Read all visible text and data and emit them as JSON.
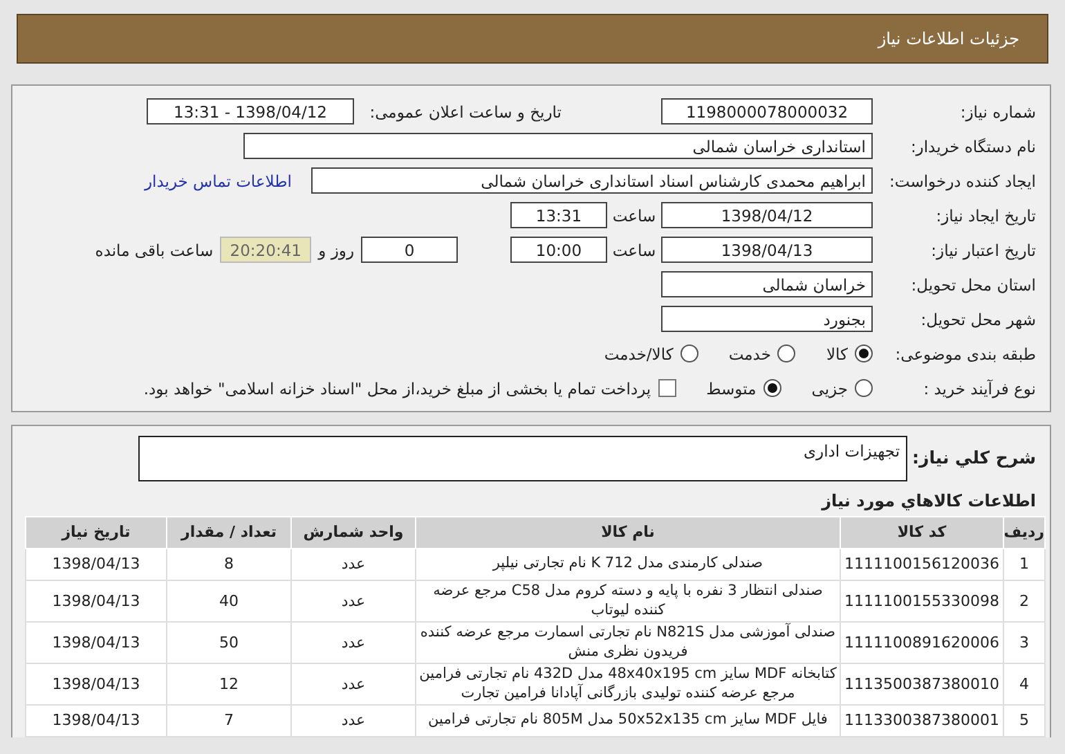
{
  "header": {
    "title": "جزئیات اطلاعات نیاز"
  },
  "form": {
    "need_number": {
      "label": "شماره نیاز:",
      "value": "1198000078000032"
    },
    "announce": {
      "label": "تاریخ و ساعت اعلان عمومی:",
      "value": "1398/04/12 - 13:31"
    },
    "buyer": {
      "label": "نام دستگاه خریدار:",
      "value": "استانداری خراسان شمالی"
    },
    "requester": {
      "label": "ایجاد کننده درخواست:",
      "value": "ابراهیم محمدی کارشناس اسناد استانداری خراسان شمالی",
      "link": "اطلاعات تماس خریدار"
    },
    "created": {
      "label": "تاریخ ایجاد نیاز:",
      "date": "1398/04/12",
      "time_label": "ساعت",
      "time": "13:31"
    },
    "validity": {
      "label": "تاریخ اعتبار نیاز:",
      "date": "1398/04/13",
      "time_label": "ساعت",
      "time": "10:00",
      "days": "0",
      "days_label": "روز و",
      "remaining": "20:20:41",
      "remaining_label": "ساعت باقی مانده"
    },
    "province": {
      "label": "استان محل تحویل:",
      "value": "خراسان شمالی"
    },
    "city": {
      "label": "شهر محل تحویل:",
      "value": "بجنورد"
    },
    "category": {
      "label": "طبقه بندی موضوعی:",
      "options": [
        {
          "label": "کالا",
          "selected": true
        },
        {
          "label": "خدمت",
          "selected": false
        },
        {
          "label": "کالا/خدمت",
          "selected": false
        }
      ]
    },
    "purchase": {
      "label": "نوع فرآیند خرید :",
      "options": [
        {
          "label": "جزیی",
          "selected": false
        },
        {
          "label": "متوسط",
          "selected": true
        }
      ],
      "payment": {
        "label": "پرداخت تمام یا بخشی از مبلغ خرید،از محل \"اسناد خزانه اسلامی\" خواهد بود.",
        "checked": false
      }
    }
  },
  "description": {
    "label": "شرح كلي نياز:",
    "value": "تجهیزات اداری"
  },
  "items": {
    "title": "اطلاعات كالاهاي مورد نياز",
    "columns": [
      "ردیف",
      "کد کالا",
      "نام کالا",
      "واحد شمارش",
      "تعداد / مقدار",
      "تاریخ نیاز"
    ],
    "rows": [
      [
        "1",
        "1111100156120036",
        "صندلی کارمندی مدل K 712 نام تجارتی نیلپر",
        "عدد",
        "8",
        "1398/04/13"
      ],
      [
        "2",
        "1111100155330098",
        "صندلی انتظار 3 نفره با پایه و دسته کروم مدل C58 مرجع عرضه کننده لیوتاب",
        "عدد",
        "40",
        "1398/04/13"
      ],
      [
        "3",
        "1111100891620006",
        "صندلی آموزشی مدل N821S نام تجارتی اسمارت مرجع عرضه کننده فریدون نظری منش",
        "عدد",
        "50",
        "1398/04/13"
      ],
      [
        "4",
        "1113500387380010",
        "کتابخانه MDF سایز 48x40x195 cm مدل 432D نام تجارتی فرامین مرجع عرضه کننده تولیدی بازرگانی آپادانا فرامین تجارت",
        "عدد",
        "12",
        "1398/04/13"
      ],
      [
        "5",
        "1113300387380001",
        "فایل MDF سایز 50x52x135 cm مدل 805M نام تجارتی فرامین",
        "عدد",
        "7",
        "1398/04/13"
      ]
    ]
  }
}
